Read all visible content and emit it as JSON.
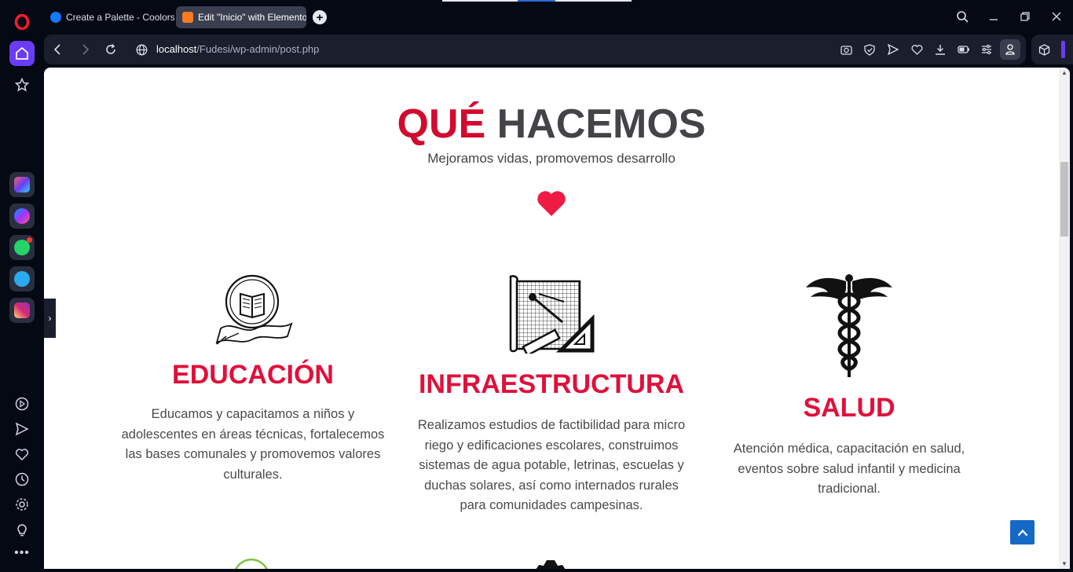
{
  "browser": {
    "tabs": [
      {
        "label": "Create a Palette - Coolors",
        "active": false
      },
      {
        "label": "Edit \"Inicio\" with Elementor",
        "active": true
      }
    ],
    "url_host": "localhost",
    "url_path": "/Fudesi/wp-admin/post.php"
  },
  "colors": {
    "accent_red": "#e0103a",
    "heading_gray": "#444448",
    "opera_purple": "#6b3cf5",
    "scroll_top_blue": "#1668c7"
  },
  "page": {
    "heading_red": "QUÉ",
    "heading_gray": "HACEMOS",
    "subheading": "Mejoramos vidas, promovemos desarrollo",
    "services": [
      {
        "icon": "education-book-emblem-icon",
        "title": "EDUCACIÓN",
        "description": "Educamos y capacitamos a niños y adolescentes en áreas técnicas, fortalecemos las bases comunales y promovemos valores culturales."
      },
      {
        "icon": "blueprint-ruler-icon",
        "title": "INFRAESTRUCTURA",
        "description": "Realizamos estudios de factibilidad para micro riego y edificaciones escolares, construimos sistemas de agua potable, letrinas, escuelas y duchas solares, así como internados rurales para comunidades campesinas."
      },
      {
        "icon": "caduceus-icon",
        "title": "SALUD",
        "description": "Atención médica, capacitación en salud, eventos sobre salud infantil y medicina tradicional."
      }
    ]
  }
}
